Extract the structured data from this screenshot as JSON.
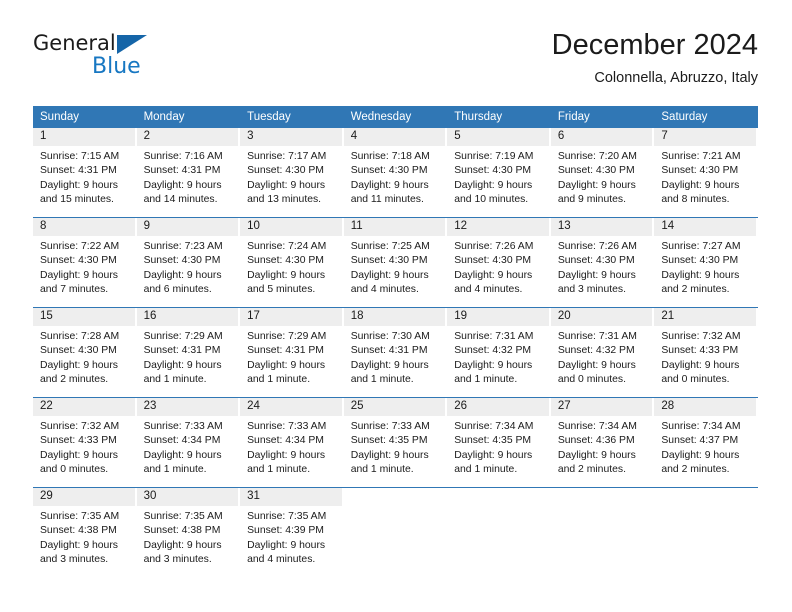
{
  "brand": {
    "name_part1": "General",
    "name_part2": "Blue",
    "triangle_color": "#1565a8",
    "blue_color": "#1777c2"
  },
  "header": {
    "title": "December 2024",
    "subtitle": "Colonnella, Abruzzo, Italy"
  },
  "colors": {
    "header_blue": "#3077b5",
    "daynum_band": "#eeeeee",
    "text": "#1b1b1b"
  },
  "weekday_headers": [
    "Sunday",
    "Monday",
    "Tuesday",
    "Wednesday",
    "Thursday",
    "Friday",
    "Saturday"
  ],
  "weeks": [
    [
      {
        "day": "1",
        "sunrise": "Sunrise: 7:15 AM",
        "sunset": "Sunset: 4:31 PM",
        "daylight1": "Daylight: 9 hours",
        "daylight2": "and 15 minutes."
      },
      {
        "day": "2",
        "sunrise": "Sunrise: 7:16 AM",
        "sunset": "Sunset: 4:31 PM",
        "daylight1": "Daylight: 9 hours",
        "daylight2": "and 14 minutes."
      },
      {
        "day": "3",
        "sunrise": "Sunrise: 7:17 AM",
        "sunset": "Sunset: 4:30 PM",
        "daylight1": "Daylight: 9 hours",
        "daylight2": "and 13 minutes."
      },
      {
        "day": "4",
        "sunrise": "Sunrise: 7:18 AM",
        "sunset": "Sunset: 4:30 PM",
        "daylight1": "Daylight: 9 hours",
        "daylight2": "and 11 minutes."
      },
      {
        "day": "5",
        "sunrise": "Sunrise: 7:19 AM",
        "sunset": "Sunset: 4:30 PM",
        "daylight1": "Daylight: 9 hours",
        "daylight2": "and 10 minutes."
      },
      {
        "day": "6",
        "sunrise": "Sunrise: 7:20 AM",
        "sunset": "Sunset: 4:30 PM",
        "daylight1": "Daylight: 9 hours",
        "daylight2": "and 9 minutes."
      },
      {
        "day": "7",
        "sunrise": "Sunrise: 7:21 AM",
        "sunset": "Sunset: 4:30 PM",
        "daylight1": "Daylight: 9 hours",
        "daylight2": "and 8 minutes."
      }
    ],
    [
      {
        "day": "8",
        "sunrise": "Sunrise: 7:22 AM",
        "sunset": "Sunset: 4:30 PM",
        "daylight1": "Daylight: 9 hours",
        "daylight2": "and 7 minutes."
      },
      {
        "day": "9",
        "sunrise": "Sunrise: 7:23 AM",
        "sunset": "Sunset: 4:30 PM",
        "daylight1": "Daylight: 9 hours",
        "daylight2": "and 6 minutes."
      },
      {
        "day": "10",
        "sunrise": "Sunrise: 7:24 AM",
        "sunset": "Sunset: 4:30 PM",
        "daylight1": "Daylight: 9 hours",
        "daylight2": "and 5 minutes."
      },
      {
        "day": "11",
        "sunrise": "Sunrise: 7:25 AM",
        "sunset": "Sunset: 4:30 PM",
        "daylight1": "Daylight: 9 hours",
        "daylight2": "and 4 minutes."
      },
      {
        "day": "12",
        "sunrise": "Sunrise: 7:26 AM",
        "sunset": "Sunset: 4:30 PM",
        "daylight1": "Daylight: 9 hours",
        "daylight2": "and 4 minutes."
      },
      {
        "day": "13",
        "sunrise": "Sunrise: 7:26 AM",
        "sunset": "Sunset: 4:30 PM",
        "daylight1": "Daylight: 9 hours",
        "daylight2": "and 3 minutes."
      },
      {
        "day": "14",
        "sunrise": "Sunrise: 7:27 AM",
        "sunset": "Sunset: 4:30 PM",
        "daylight1": "Daylight: 9 hours",
        "daylight2": "and 2 minutes."
      }
    ],
    [
      {
        "day": "15",
        "sunrise": "Sunrise: 7:28 AM",
        "sunset": "Sunset: 4:30 PM",
        "daylight1": "Daylight: 9 hours",
        "daylight2": "and 2 minutes."
      },
      {
        "day": "16",
        "sunrise": "Sunrise: 7:29 AM",
        "sunset": "Sunset: 4:31 PM",
        "daylight1": "Daylight: 9 hours",
        "daylight2": "and 1 minute."
      },
      {
        "day": "17",
        "sunrise": "Sunrise: 7:29 AM",
        "sunset": "Sunset: 4:31 PM",
        "daylight1": "Daylight: 9 hours",
        "daylight2": "and 1 minute."
      },
      {
        "day": "18",
        "sunrise": "Sunrise: 7:30 AM",
        "sunset": "Sunset: 4:31 PM",
        "daylight1": "Daylight: 9 hours",
        "daylight2": "and 1 minute."
      },
      {
        "day": "19",
        "sunrise": "Sunrise: 7:31 AM",
        "sunset": "Sunset: 4:32 PM",
        "daylight1": "Daylight: 9 hours",
        "daylight2": "and 1 minute."
      },
      {
        "day": "20",
        "sunrise": "Sunrise: 7:31 AM",
        "sunset": "Sunset: 4:32 PM",
        "daylight1": "Daylight: 9 hours",
        "daylight2": "and 0 minutes."
      },
      {
        "day": "21",
        "sunrise": "Sunrise: 7:32 AM",
        "sunset": "Sunset: 4:33 PM",
        "daylight1": "Daylight: 9 hours",
        "daylight2": "and 0 minutes."
      }
    ],
    [
      {
        "day": "22",
        "sunrise": "Sunrise: 7:32 AM",
        "sunset": "Sunset: 4:33 PM",
        "daylight1": "Daylight: 9 hours",
        "daylight2": "and 0 minutes."
      },
      {
        "day": "23",
        "sunrise": "Sunrise: 7:33 AM",
        "sunset": "Sunset: 4:34 PM",
        "daylight1": "Daylight: 9 hours",
        "daylight2": "and 1 minute."
      },
      {
        "day": "24",
        "sunrise": "Sunrise: 7:33 AM",
        "sunset": "Sunset: 4:34 PM",
        "daylight1": "Daylight: 9 hours",
        "daylight2": "and 1 minute."
      },
      {
        "day": "25",
        "sunrise": "Sunrise: 7:33 AM",
        "sunset": "Sunset: 4:35 PM",
        "daylight1": "Daylight: 9 hours",
        "daylight2": "and 1 minute."
      },
      {
        "day": "26",
        "sunrise": "Sunrise: 7:34 AM",
        "sunset": "Sunset: 4:35 PM",
        "daylight1": "Daylight: 9 hours",
        "daylight2": "and 1 minute."
      },
      {
        "day": "27",
        "sunrise": "Sunrise: 7:34 AM",
        "sunset": "Sunset: 4:36 PM",
        "daylight1": "Daylight: 9 hours",
        "daylight2": "and 2 minutes."
      },
      {
        "day": "28",
        "sunrise": "Sunrise: 7:34 AM",
        "sunset": "Sunset: 4:37 PM",
        "daylight1": "Daylight: 9 hours",
        "daylight2": "and 2 minutes."
      }
    ],
    [
      {
        "day": "29",
        "sunrise": "Sunrise: 7:35 AM",
        "sunset": "Sunset: 4:38 PM",
        "daylight1": "Daylight: 9 hours",
        "daylight2": "and 3 minutes."
      },
      {
        "day": "30",
        "sunrise": "Sunrise: 7:35 AM",
        "sunset": "Sunset: 4:38 PM",
        "daylight1": "Daylight: 9 hours",
        "daylight2": "and 3 minutes."
      },
      {
        "day": "31",
        "sunrise": "Sunrise: 7:35 AM",
        "sunset": "Sunset: 4:39 PM",
        "daylight1": "Daylight: 9 hours",
        "daylight2": "and 4 minutes."
      },
      {
        "day": "",
        "sunrise": "",
        "sunset": "",
        "daylight1": "",
        "daylight2": ""
      },
      {
        "day": "",
        "sunrise": "",
        "sunset": "",
        "daylight1": "",
        "daylight2": ""
      },
      {
        "day": "",
        "sunrise": "",
        "sunset": "",
        "daylight1": "",
        "daylight2": ""
      },
      {
        "day": "",
        "sunrise": "",
        "sunset": "",
        "daylight1": "",
        "daylight2": ""
      }
    ]
  ]
}
